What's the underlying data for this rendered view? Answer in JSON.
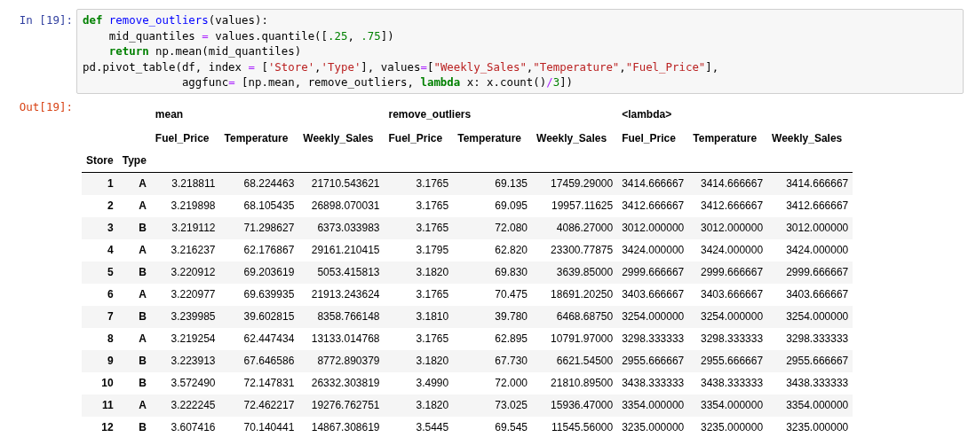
{
  "input_cell": {
    "prompt": "In [19]:",
    "lines": [
      [
        {
          "kind": "keyword",
          "text": "def"
        },
        {
          "kind": "function",
          "text": " remove_outliers"
        },
        {
          "kind": "plain",
          "text": "(values):"
        }
      ],
      [
        {
          "kind": "plain",
          "text": "    mid_quantiles "
        },
        {
          "kind": "operator",
          "text": "="
        },
        {
          "kind": "plain",
          "text": " values.quantile(["
        },
        {
          "kind": "number",
          "text": ".25"
        },
        {
          "kind": "plain",
          "text": ", "
        },
        {
          "kind": "number",
          "text": ".75"
        },
        {
          "kind": "plain",
          "text": "])"
        }
      ],
      [
        {
          "kind": "keyword",
          "text": "    return"
        },
        {
          "kind": "plain",
          "text": " np.mean(mid_quantiles)"
        }
      ],
      [
        {
          "kind": "plain",
          "text": "pd.pivot_table(df, index "
        },
        {
          "kind": "operator",
          "text": "="
        },
        {
          "kind": "plain",
          "text": " ["
        },
        {
          "kind": "string",
          "text": "'Store'"
        },
        {
          "kind": "plain",
          "text": ","
        },
        {
          "kind": "string",
          "text": "'Type'"
        },
        {
          "kind": "plain",
          "text": "], values"
        },
        {
          "kind": "operator",
          "text": "="
        },
        {
          "kind": "plain",
          "text": "["
        },
        {
          "kind": "string",
          "text": "\"Weekly_Sales\""
        },
        {
          "kind": "plain",
          "text": ","
        },
        {
          "kind": "string",
          "text": "\"Temperature\""
        },
        {
          "kind": "plain",
          "text": ","
        },
        {
          "kind": "string",
          "text": "\"Fuel_Price\""
        },
        {
          "kind": "plain",
          "text": "],"
        }
      ],
      [
        {
          "kind": "plain",
          "text": "               aggfunc"
        },
        {
          "kind": "operator",
          "text": "="
        },
        {
          "kind": "plain",
          "text": " [np.mean, remove_outliers, "
        },
        {
          "kind": "keyword",
          "text": "lambda"
        },
        {
          "kind": "plain",
          "text": " x: x.count()"
        },
        {
          "kind": "operator",
          "text": "/"
        },
        {
          "kind": "number",
          "text": "3"
        },
        {
          "kind": "plain",
          "text": "])"
        }
      ]
    ]
  },
  "output_cell": {
    "prompt": "Out[19]:",
    "table": {
      "index_names": [
        "Store",
        "Type"
      ],
      "groups": [
        {
          "label": "mean",
          "columns": [
            "Fuel_Price",
            "Temperature",
            "Weekly_Sales"
          ]
        },
        {
          "label": "remove_outliers",
          "columns": [
            "Fuel_Price",
            "Temperature",
            "Weekly_Sales"
          ]
        },
        {
          "label": "<lambda>",
          "columns": [
            "Fuel_Price",
            "Temperature",
            "Weekly_Sales"
          ]
        }
      ],
      "rows": [
        {
          "index": [
            "1",
            "A"
          ],
          "values": [
            "3.218811",
            "68.224463",
            "21710.543621",
            "3.1765",
            "69.135",
            "17459.29000",
            "3414.666667",
            "3414.666667",
            "3414.666667"
          ]
        },
        {
          "index": [
            "2",
            "A"
          ],
          "values": [
            "3.219898",
            "68.105435",
            "26898.070031",
            "3.1765",
            "69.095",
            "19957.11625",
            "3412.666667",
            "3412.666667",
            "3412.666667"
          ]
        },
        {
          "index": [
            "3",
            "B"
          ],
          "values": [
            "3.219112",
            "71.298627",
            "6373.033983",
            "3.1765",
            "72.080",
            "4086.27000",
            "3012.000000",
            "3012.000000",
            "3012.000000"
          ]
        },
        {
          "index": [
            "4",
            "A"
          ],
          "values": [
            "3.216237",
            "62.176867",
            "29161.210415",
            "3.1795",
            "62.820",
            "23300.77875",
            "3424.000000",
            "3424.000000",
            "3424.000000"
          ]
        },
        {
          "index": [
            "5",
            "B"
          ],
          "values": [
            "3.220912",
            "69.203619",
            "5053.415813",
            "3.1820",
            "69.830",
            "3639.85000",
            "2999.666667",
            "2999.666667",
            "2999.666667"
          ]
        },
        {
          "index": [
            "6",
            "A"
          ],
          "values": [
            "3.220977",
            "69.639935",
            "21913.243624",
            "3.1765",
            "70.475",
            "18691.20250",
            "3403.666667",
            "3403.666667",
            "3403.666667"
          ]
        },
        {
          "index": [
            "7",
            "B"
          ],
          "values": [
            "3.239985",
            "39.602815",
            "8358.766148",
            "3.1810",
            "39.780",
            "6468.68750",
            "3254.000000",
            "3254.000000",
            "3254.000000"
          ]
        },
        {
          "index": [
            "8",
            "A"
          ],
          "values": [
            "3.219254",
            "62.447434",
            "13133.014768",
            "3.1765",
            "62.895",
            "10791.97000",
            "3298.333333",
            "3298.333333",
            "3298.333333"
          ]
        },
        {
          "index": [
            "9",
            "B"
          ],
          "values": [
            "3.223913",
            "67.646586",
            "8772.890379",
            "3.1820",
            "67.730",
            "6621.54500",
            "2955.666667",
            "2955.666667",
            "2955.666667"
          ]
        },
        {
          "index": [
            "10",
            "B"
          ],
          "values": [
            "3.572490",
            "72.147831",
            "26332.303819",
            "3.4990",
            "72.000",
            "21810.89500",
            "3438.333333",
            "3438.333333",
            "3438.333333"
          ]
        },
        {
          "index": [
            "11",
            "A"
          ],
          "values": [
            "3.222245",
            "72.462217",
            "19276.762751",
            "3.1820",
            "73.025",
            "15936.47000",
            "3354.000000",
            "3354.000000",
            "3354.000000"
          ]
        },
        {
          "index": [
            "12",
            "B"
          ],
          "values": [
            "3.607416",
            "70.140441",
            "14867.308619",
            "3.5445",
            "69.545",
            "11545.56000",
            "3235.000000",
            "3235.000000",
            "3235.000000"
          ]
        }
      ]
    }
  }
}
